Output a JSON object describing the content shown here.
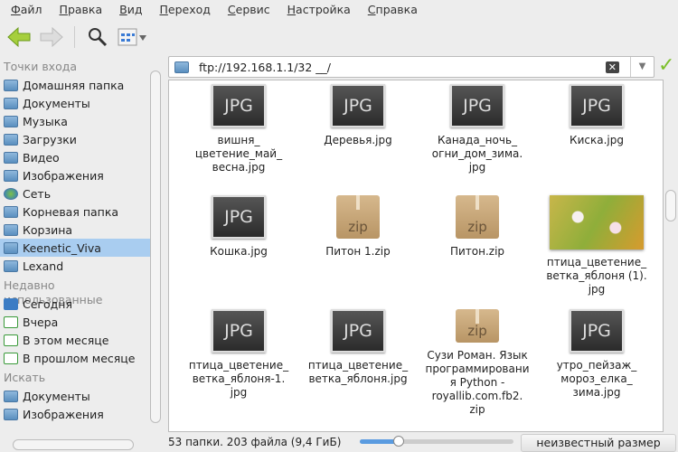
{
  "menu": [
    "Файл",
    "Правка",
    "Вид",
    "Переход",
    "Сервис",
    "Настройка",
    "Справка"
  ],
  "path": "ftp://192.168.1.1/32 __/",
  "sidebar": {
    "sections": [
      {
        "title": "Точки входа",
        "items": [
          "Домашняя папка",
          "Документы",
          "Музыка",
          "Загрузки",
          "Видео",
          "Изображения",
          "Сеть",
          "Корневая папка",
          "Корзина",
          "Keenetic_Viva",
          "Lexand"
        ]
      },
      {
        "title": "Недавно использованные",
        "items": [
          "Сегодня",
          "Вчера",
          "В этом месяце",
          "В прошлом месяце"
        ]
      },
      {
        "title": "Искать",
        "items": [
          "Документы",
          "Изображения"
        ]
      }
    ],
    "selected": "Keenetic_Viva"
  },
  "files": [
    {
      "name": "вишня_ цветение_май_ весна.jpg",
      "type": "jpg"
    },
    {
      "name": "Деревья.jpg",
      "type": "jpg"
    },
    {
      "name": "Канада_ночь_ огни_дом_зима. jpg",
      "type": "jpg"
    },
    {
      "name": "Киска.jpg",
      "type": "jpg"
    },
    {
      "name": "Кошка.jpg",
      "type": "jpg"
    },
    {
      "name": "Питон 1.zip",
      "type": "zip"
    },
    {
      "name": "Питон.zip",
      "type": "zip"
    },
    {
      "name": "птица_цветение_ ветка_яблоня (1). jpg",
      "type": "photo"
    },
    {
      "name": "птица_цветение_ ветка_яблоня-1. jpg",
      "type": "jpg"
    },
    {
      "name": "птица_цветение_ ветка_яблоня.jpg",
      "type": "jpg"
    },
    {
      "name": "Сузи Роман. Язык программирования Python - royallib.com.fb2. zip",
      "type": "zip"
    },
    {
      "name": "утро_пейзаж_ мороз_елка_ зима.jpg",
      "type": "jpg"
    }
  ],
  "icon_text": {
    "jpg": "JPG",
    "zip": "zip"
  },
  "status": "53 папки. 203 файла (9,4 ГиБ)",
  "zoom_percent": 25,
  "size_button": "неизвестный размер"
}
